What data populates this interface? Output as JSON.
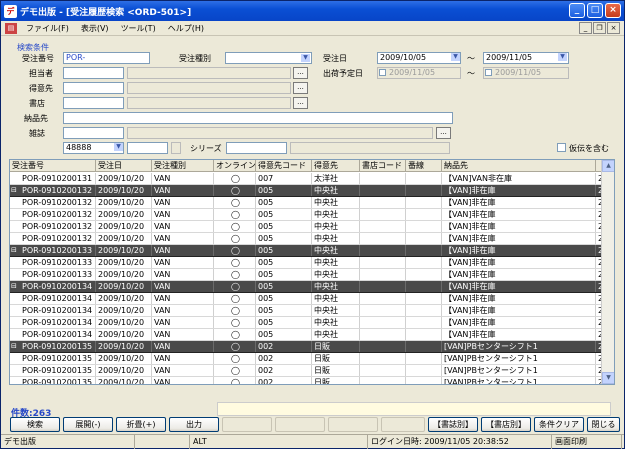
{
  "app": {
    "title": "デモ出版 - [受注履歴検索 <ORD-501>]",
    "icon": "デ"
  },
  "menu": [
    "ファイル(F)",
    "表示(V)",
    "ツール(T)",
    "ヘルプ(H)"
  ],
  "form": {
    "section": "検索条件",
    "order_no_label": "受注番号",
    "order_no_value": "POR-",
    "order_type_label": "受注種別",
    "order_date_label": "受注日",
    "order_date_from": "2009/10/05",
    "order_date_to": "2009/11/05",
    "tilde": "〜",
    "ship_date_label": "出荷予定日",
    "ship_date_from": "2009/11/05",
    "ship_date_to": "2009/11/05",
    "staff_label": "担当者",
    "customer_label": "得意先",
    "store_label": "書店",
    "delivery_label": "納品先",
    "magazine_label": "雑誌",
    "magazine_code": "48888",
    "series_label": "シリーズ",
    "provisional_label": "仮伝を含む"
  },
  "grid": {
    "headers": [
      "受注番号",
      "受注日",
      "受注種別",
      "オンライン",
      "得意先コード",
      "得意先",
      "書店コード",
      "番線",
      "納品先",
      ""
    ],
    "rows": [
      {
        "g": false,
        "c": [
          "POR-0910200131",
          "2009/10/20",
          "VAN",
          "◯",
          "007",
          "太洋社",
          "",
          "",
          "【VAN]VAN非在庫",
          "2"
        ]
      },
      {
        "g": true,
        "c": [
          "POR-0910200132",
          "2009/10/20",
          "VAN",
          "◯",
          "005",
          "中央社",
          "",
          "",
          "【VAN]非在庫",
          "2"
        ]
      },
      {
        "g": false,
        "c": [
          "POR-0910200132",
          "2009/10/20",
          "VAN",
          "◯",
          "005",
          "中央社",
          "",
          "",
          "【VAN]非在庫",
          "2"
        ]
      },
      {
        "g": false,
        "c": [
          "POR-0910200132",
          "2009/10/20",
          "VAN",
          "◯",
          "005",
          "中央社",
          "",
          "",
          "【VAN]非在庫",
          "2"
        ]
      },
      {
        "g": false,
        "c": [
          "POR-0910200132",
          "2009/10/20",
          "VAN",
          "◯",
          "005",
          "中央社",
          "",
          "",
          "【VAN]非在庫",
          "2"
        ]
      },
      {
        "g": false,
        "c": [
          "POR-0910200132",
          "2009/10/20",
          "VAN",
          "◯",
          "005",
          "中央社",
          "",
          "",
          "【VAN]非在庫",
          "2"
        ]
      },
      {
        "g": true,
        "c": [
          "POR-0910200133",
          "2009/10/20",
          "VAN",
          "◯",
          "005",
          "中央社",
          "",
          "",
          "【VAN]非在庫",
          "2"
        ]
      },
      {
        "g": false,
        "c": [
          "POR-0910200133",
          "2009/10/20",
          "VAN",
          "◯",
          "005",
          "中央社",
          "",
          "",
          "【VAN]非在庫",
          "2"
        ]
      },
      {
        "g": false,
        "c": [
          "POR-0910200133",
          "2009/10/20",
          "VAN",
          "◯",
          "005",
          "中央社",
          "",
          "",
          "【VAN]非在庫",
          "2"
        ]
      },
      {
        "g": true,
        "c": [
          "POR-0910200134",
          "2009/10/20",
          "VAN",
          "◯",
          "005",
          "中央社",
          "",
          "",
          "【VAN]非在庫",
          "2"
        ]
      },
      {
        "g": false,
        "c": [
          "POR-0910200134",
          "2009/10/20",
          "VAN",
          "◯",
          "005",
          "中央社",
          "",
          "",
          "【VAN]非在庫",
          "2"
        ]
      },
      {
        "g": false,
        "c": [
          "POR-0910200134",
          "2009/10/20",
          "VAN",
          "◯",
          "005",
          "中央社",
          "",
          "",
          "【VAN]非在庫",
          "2"
        ]
      },
      {
        "g": false,
        "c": [
          "POR-0910200134",
          "2009/10/20",
          "VAN",
          "◯",
          "005",
          "中央社",
          "",
          "",
          "【VAN]非在庫",
          "2"
        ]
      },
      {
        "g": false,
        "c": [
          "POR-0910200134",
          "2009/10/20",
          "VAN",
          "◯",
          "005",
          "中央社",
          "",
          "",
          "【VAN]非在庫",
          "2"
        ]
      },
      {
        "g": true,
        "c": [
          "POR-0910200135",
          "2009/10/20",
          "VAN",
          "◯",
          "002",
          "日販",
          "",
          "",
          "[VAN]PBセンターシフト1",
          "2"
        ]
      },
      {
        "g": false,
        "c": [
          "POR-0910200135",
          "2009/10/20",
          "VAN",
          "◯",
          "002",
          "日販",
          "",
          "",
          "[VAN]PBセンターシフト1",
          "2"
        ]
      },
      {
        "g": false,
        "c": [
          "POR-0910200135",
          "2009/10/20",
          "VAN",
          "◯",
          "002",
          "日販",
          "",
          "",
          "[VAN]PBセンターシフト1",
          "2"
        ]
      },
      {
        "g": false,
        "c": [
          "POR-0910200135",
          "2009/10/20",
          "VAN",
          "◯",
          "002",
          "日販",
          "",
          "",
          "[VAN]PBセンターシフト1",
          "2"
        ]
      }
    ]
  },
  "count_label": "件数:263",
  "buttons": {
    "search": "検索",
    "expand": "展開(-)",
    "collapse": "折畳(+)",
    "output": "出力",
    "by_magazine": "【書誌別】",
    "by_store": "【書店別】",
    "clear": "条件クリア",
    "close": "閉じる"
  },
  "status": {
    "app": "デモ出版",
    "mode": "ALT",
    "login": "ログイン日時: 2009/11/05 20:38:52",
    "print": "画面印刷"
  }
}
